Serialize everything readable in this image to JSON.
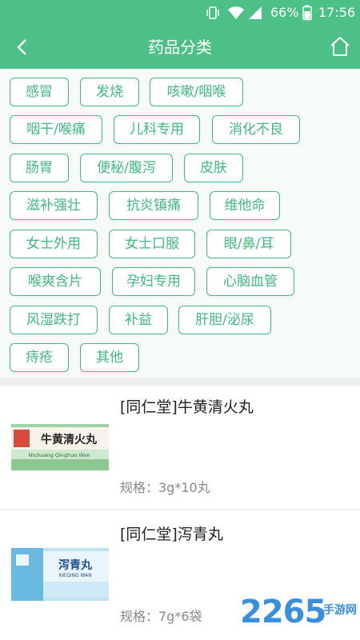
{
  "status_bar": {
    "battery": "66%",
    "time": "17:56"
  },
  "header": {
    "title": "药品分类"
  },
  "categories": [
    "感冒",
    "发烧",
    "咳嗽/咽喉",
    "咽干/喉痛",
    "儿科专用",
    "消化不良",
    "肠胃",
    "便秘/腹泻",
    "皮肤",
    "滋补强壮",
    "抗炎镇痛",
    "维他命",
    "女士外用",
    "女士口服",
    "眼/鼻/耳",
    "喉爽含片",
    "孕妇专用",
    "心脑血管",
    "风湿跌打",
    "补益",
    "肝胆/泌尿",
    "痔疮",
    "其他"
  ],
  "products": [
    {
      "name": "[同仁堂]牛黄清火丸",
      "spec": "规格：3g*10丸",
      "box_title": "牛黄清火丸",
      "box_pinyin": "Niuhuang Qinghuo Wan"
    },
    {
      "name": "[同仁堂]泻青丸",
      "spec": "规格：7g*6袋",
      "box_title": "泻青丸",
      "box_pinyin": "XIEQING WAN"
    }
  ],
  "watermark": {
    "number": "2265",
    "suffix": "手游网"
  },
  "colors": {
    "accent": "#4dc088",
    "chip_border": "#44b67f"
  }
}
